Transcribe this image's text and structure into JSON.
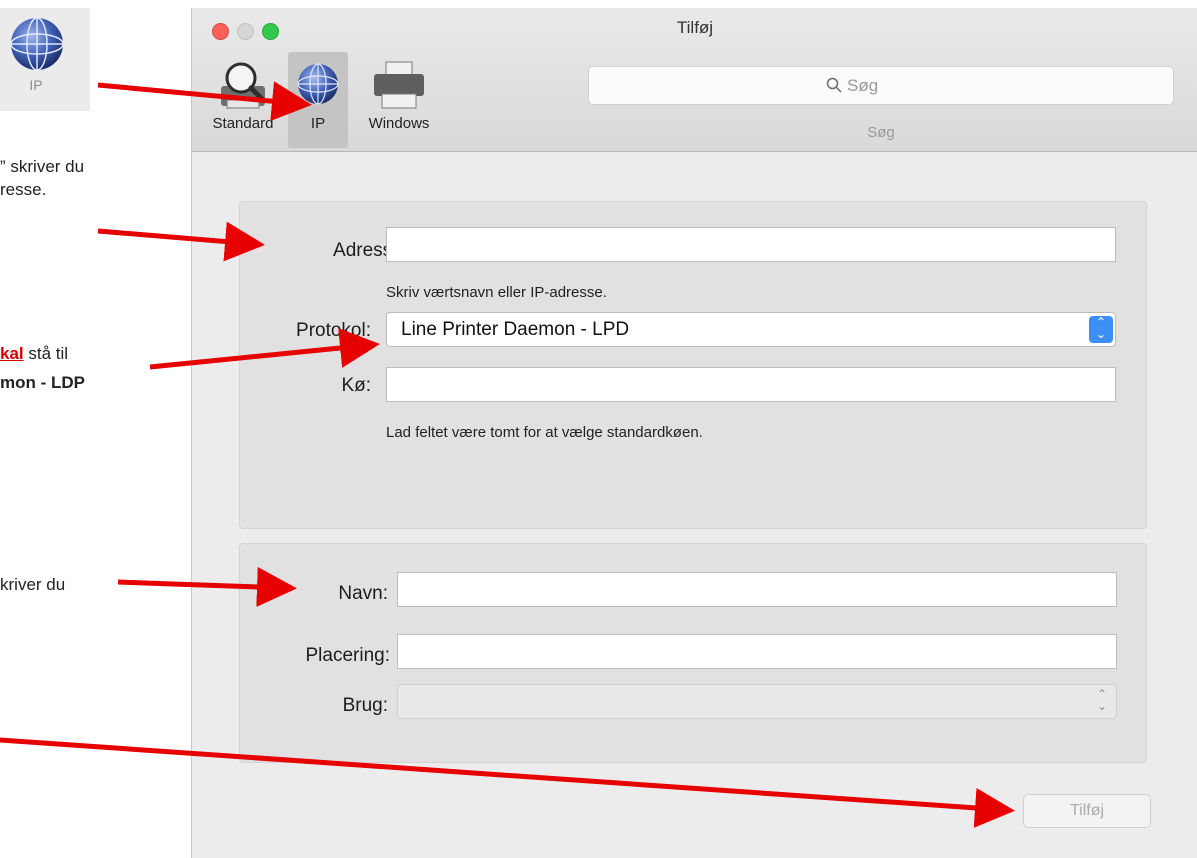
{
  "ip_badge": {
    "label": "IP"
  },
  "notes": {
    "address_line1": "” skriver du",
    "address_line2": "resse.",
    "protocol_line1_emph": "kal",
    "protocol_line1_rest": " stå til",
    "protocol_line2": "mon - LDP",
    "name_line": "kriver du"
  },
  "window": {
    "title": "Tilføj",
    "toolbar": {
      "standard_label": "Standard",
      "ip_label": "IP",
      "windows_label": "Windows",
      "search_placeholder": "Søg",
      "search_caption": "Søg"
    },
    "form": {
      "address_label": "Adresse:",
      "address_value": "",
      "address_hint": "Skriv værtsnavn eller IP-adresse.",
      "protocol_label": "Protokol:",
      "protocol_value": "Line Printer Daemon - LPD",
      "queue_label": "Kø:",
      "queue_value": "",
      "queue_hint": "Lad feltet være tomt for at vælge standardkøen.",
      "name_label": "Navn:",
      "name_value": "",
      "location_label": "Placering:",
      "location_value": "",
      "use_label": "Brug:",
      "use_value": ""
    },
    "add_button_label": "Tilføj"
  },
  "colors": {
    "arrow": "#e60000",
    "close": "#fc605b",
    "maximize": "#34c84a",
    "accent": "#3d8ff6"
  }
}
